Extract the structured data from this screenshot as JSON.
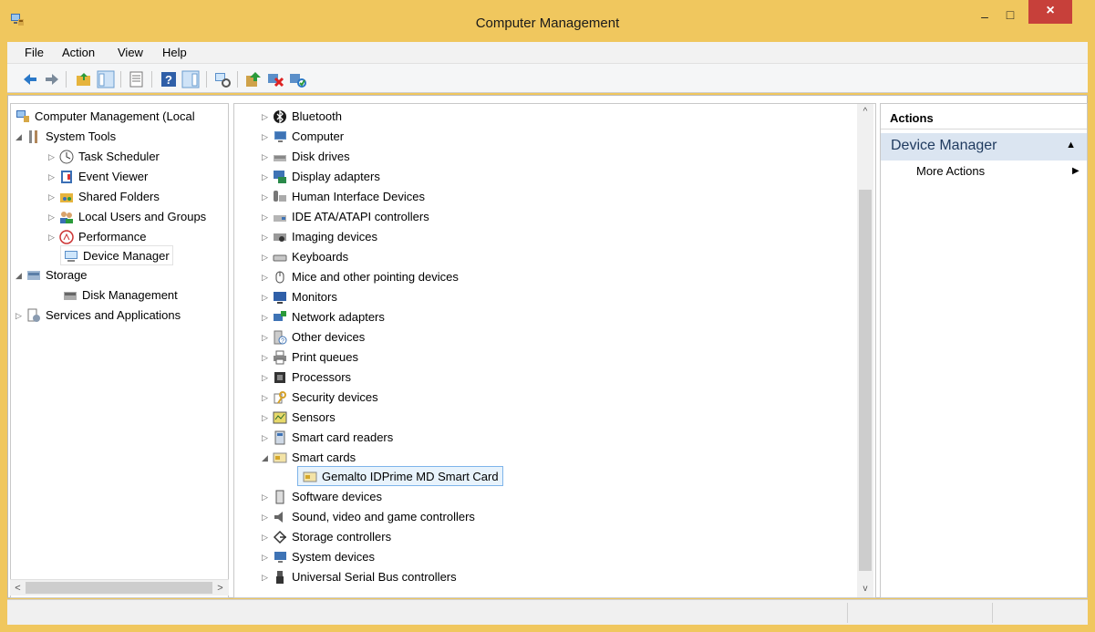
{
  "window": {
    "title": "Computer Management",
    "minimize_glyph": "–",
    "maximize_glyph": "□",
    "close_glyph": "×"
  },
  "menu": [
    "File",
    "Action",
    "View",
    "Help"
  ],
  "toolbar": {
    "icons": [
      "back-arrow-icon",
      "forward-arrow-icon",
      "up-folder-icon",
      "show-hide-tree-icon",
      "properties-icon",
      "help-icon",
      "show-hide-action-pane-icon",
      "scan-hardware-icon",
      "update-driver-icon",
      "uninstall-icon",
      "enable-device-icon"
    ]
  },
  "left_tree": {
    "root": "Computer Management (Local",
    "items": [
      {
        "label": "System Tools",
        "expanded": true,
        "icon": "tools-icon"
      },
      {
        "label": "Task Scheduler",
        "icon": "clock-icon"
      },
      {
        "label": "Event Viewer",
        "icon": "event-viewer-icon"
      },
      {
        "label": "Shared Folders",
        "icon": "shared-folder-icon"
      },
      {
        "label": "Local Users and Groups",
        "icon": "users-icon"
      },
      {
        "label": "Performance",
        "icon": "performance-icon"
      },
      {
        "label": "Device Manager",
        "icon": "device-manager-icon",
        "selected": true
      },
      {
        "label": "Storage",
        "expanded": true,
        "icon": "storage-icon"
      },
      {
        "label": "Disk Management",
        "icon": "disk-management-icon"
      },
      {
        "label": "Services and Applications",
        "icon": "services-icon"
      }
    ],
    "scroll_left": "<",
    "scroll_right": ">"
  },
  "device_tree": {
    "categories": [
      "Bluetooth",
      "Computer",
      "Disk drives",
      "Display adapters",
      "Human Interface Devices",
      "IDE ATA/ATAPI controllers",
      "Imaging devices",
      "Keyboards",
      "Mice and other pointing devices",
      "Monitors",
      "Network adapters",
      "Other devices",
      "Print queues",
      "Processors",
      "Security devices",
      "Sensors",
      "Smart card readers",
      "Smart cards",
      "Gemalto IDPrime MD Smart Card",
      "Software devices",
      "Sound, video and game controllers",
      "Storage controllers",
      "System devices",
      "Universal Serial Bus controllers"
    ],
    "scroll_up": "^",
    "scroll_down": "v"
  },
  "actions": {
    "header": "Actions",
    "section": "Device Manager",
    "section_toggle": "▲",
    "more": "More Actions",
    "more_arrow": "▶"
  }
}
